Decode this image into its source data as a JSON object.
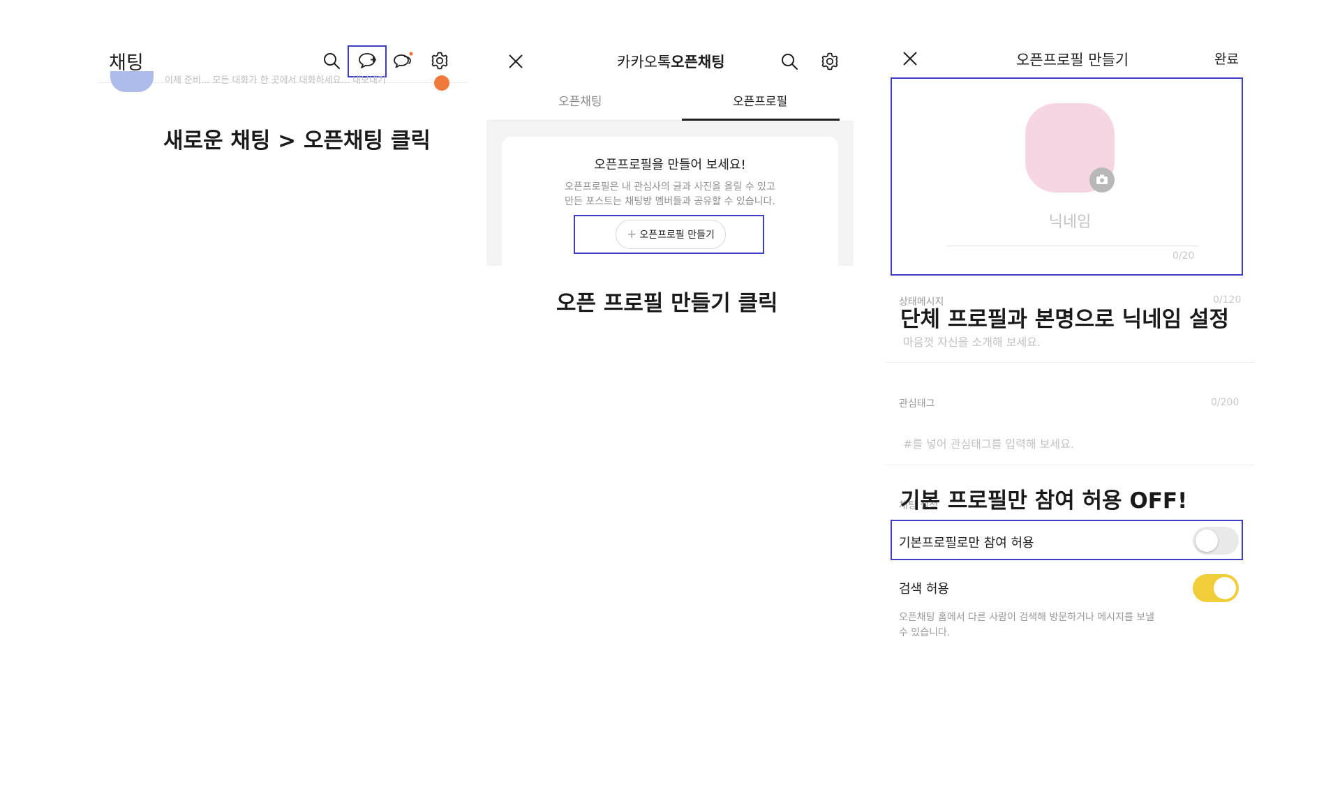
{
  "panel1": {
    "header_title": "채팅",
    "preview_text": "이제 준비... 모든 대화가 한 곳에서 대화하세요... 내보내기",
    "caption": "새로운 채팅 > 오픈채팅 클릭",
    "icons": [
      "search-icon",
      "new-chat-icon",
      "open-chat-icon",
      "gear-icon"
    ]
  },
  "panel2": {
    "title_plain": "카카오톡",
    "title_bold": "오픈채팅",
    "tabs": [
      {
        "label": "오픈채팅",
        "active": false
      },
      {
        "label": "오픈프로필",
        "active": true
      }
    ],
    "card_title": "오픈프로필을 만들어 보세요!",
    "card_desc_line1": "오픈프로필은 내 관심사의 글과 사진을 올릴 수 있고",
    "card_desc_line2": "만든 포스트는 채팅방 멤버들과 공유할 수 있습니다.",
    "create_button_icon": "+",
    "create_button_label": "오픈프로필 만들기",
    "caption": "오픈 프로필 만들기 클릭",
    "icons": [
      "close-icon",
      "search-icon",
      "gear-icon"
    ]
  },
  "panel3": {
    "title": "오픈프로필 만들기",
    "done_label": "완료",
    "nickname_placeholder": "닉네임",
    "nickname_count": "0/20",
    "status_label": "상태메시지",
    "status_count": "0/120",
    "status_placeholder": "마음껏 자신을 소개해 보세요.",
    "caption_nickname": "단체 프로필과 본명으로 닉네임 설정",
    "tags_label": "관심태그",
    "tags_count": "0/200",
    "tags_placeholder": "#를 넣어 관심태그를 입력해 보세요.",
    "chat_settings_label": "채팅 설정",
    "caption_toggle": "기본 프로필만 참여 허용 OFF!",
    "toggle1_label": "기본프로필로만 참여 허용",
    "toggle1_on": false,
    "toggle2_label": "검색 허용",
    "toggle2_on": true,
    "search_desc_line1": "오픈채팅 홈에서 다른 사람이 검색해 방문하거나 메시지를 보낼",
    "search_desc_line2": "수 있습니다.",
    "icons": [
      "close-icon",
      "camera-icon"
    ]
  },
  "colors": {
    "highlight_box": "#3b3dc4",
    "toggle_on": "#f2cd3a",
    "avatar_pink": "#f7d6e3",
    "notification_dot": "#f07a3c"
  }
}
